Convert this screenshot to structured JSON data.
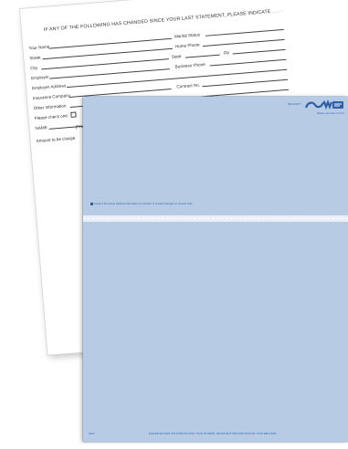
{
  "form": {
    "heading": "IF ANY OF THE FOLLOWING HAS CHANGED SINCE YOUR LAST STATEMENT, PLEASE INDICATE . . . .",
    "fields": {
      "your_name": "Your Name",
      "marital_status": "Marital Status",
      "street": "Street",
      "home_phone": "Home Phone",
      "city": "City",
      "state": "State",
      "zip": "Zip",
      "employer": "Employer",
      "business_phone": "Business Phone",
      "employer_address": "Employer Address",
      "insurance_company": "Insurance Company",
      "contract_no": "Contract No.",
      "other_information": "Other Information",
      "please_check_one": "Please check one:",
      "name": "NAME",
      "print": "(Print",
      "amount": "Amount to be charge"
    }
  },
  "check": {
    "top_right_code": "BE ACCPT",
    "top_right_subtext": "Please see back of form",
    "address_note": "Check if the above address information is incorrect. If needed changes on reverse side.",
    "bottom_code": "24CC",
    "bottom_instruction": "PLEASE RETURN TOP PORTION WITH YOUR PAYMENT. RETAIN BOTTOM PORTION FOR YOUR RECORDS",
    "colors": {
      "paper": "#b8cbe5",
      "ink": "#2f5fa7"
    },
    "logo_icon": "company-logo-icon"
  }
}
